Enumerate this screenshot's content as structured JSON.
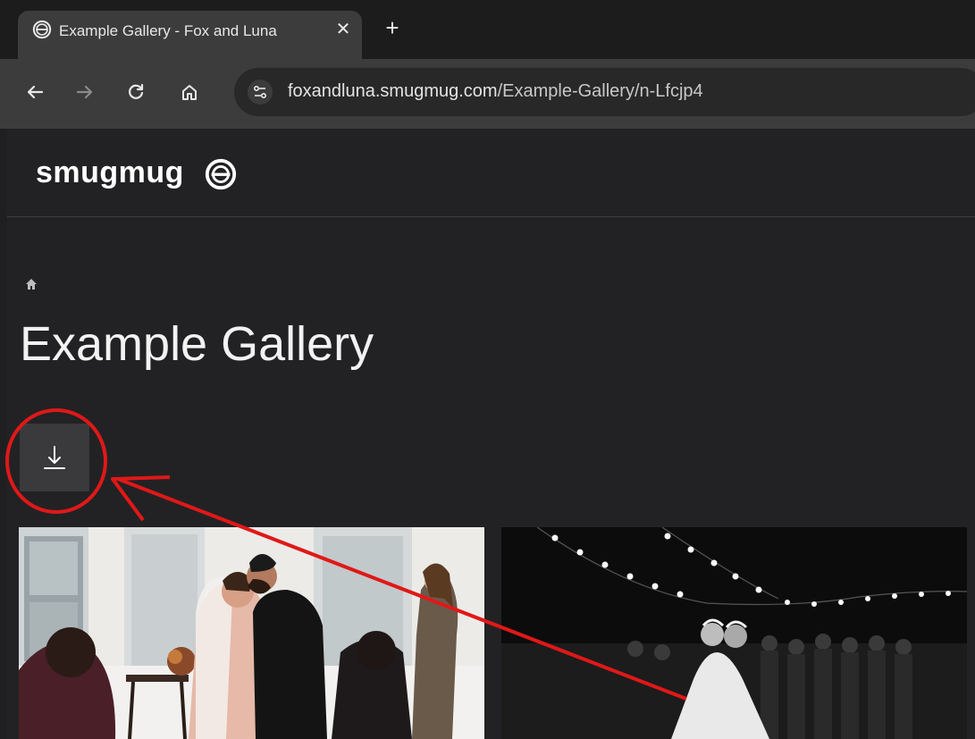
{
  "browser": {
    "tab": {
      "title": "Example Gallery - Fox and Luna",
      "close": "✕"
    },
    "new_tab": "+",
    "url": {
      "host": "foxandluna.smugmug.com",
      "path": "/Example-Gallery/n-Lfcjp4"
    }
  },
  "site": {
    "logo_text": "smugmug",
    "page_title": "Example Gallery"
  },
  "colors": {
    "annotation_red": "#e01818",
    "page_bg": "#222224",
    "button_bg": "#3a3a3d"
  },
  "icons": [
    "smugmug-favicon",
    "close-icon",
    "plus-icon",
    "back-arrow-icon",
    "forward-arrow-icon",
    "reload-icon",
    "home-icon",
    "site-info-icon",
    "smiley-logo-icon",
    "download-icon"
  ]
}
